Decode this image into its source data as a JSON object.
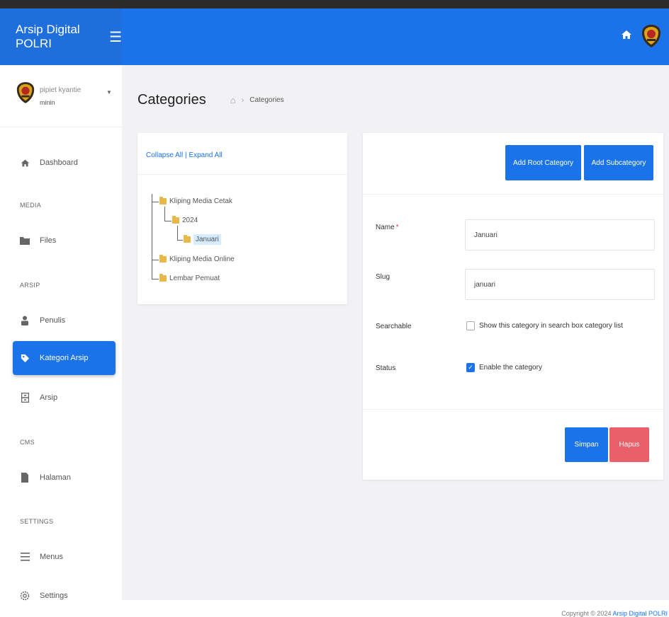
{
  "app": {
    "title": "Arsip Digital POLRI"
  },
  "user": {
    "name": "pipiet kyantie",
    "role": "minin"
  },
  "sidebar": {
    "dashboard": "Dashboard",
    "media_section": "MEDIA",
    "files": "Files",
    "arsip_section": "ARSIP",
    "penulis": "Penulis",
    "kategori": "Kategori Arsip",
    "arsip": "Arsip",
    "cms_section": "CMS",
    "halaman": "Halaman",
    "settings_section": "SETTINGS",
    "menus": "Menus",
    "settings": "Settings"
  },
  "page": {
    "title": "Categories",
    "breadcrumb_current": "Categories"
  },
  "tree": {
    "collapse_all": "Collapse All",
    "separator": "|",
    "expand_all": "Expand All",
    "nodes": {
      "kliping_cetak": "Kliping Media Cetak",
      "year_2024": "2024",
      "januari": "Januari",
      "kliping_online": "Kliping Media Online",
      "lembar_pemuat": "Lembar Pemuat"
    }
  },
  "form": {
    "add_root": "Add Root Category",
    "add_sub": "Add Subcategory",
    "name_label": "Name",
    "name_required": "*",
    "name_value": "Januari",
    "slug_label": "Slug",
    "slug_value": "januari",
    "searchable_label": "Searchable",
    "searchable_text": "Show this category in search box category list",
    "searchable_checked": false,
    "status_label": "Status",
    "status_text": "Enable the category",
    "status_checked": true,
    "save": "Simpan",
    "delete": "Hapus"
  },
  "footer": {
    "prefix": "Copyright © 2024",
    "brand": "Arsip Digital POLRI"
  },
  "colors": {
    "primary": "#1a73e8",
    "danger": "#e9606b",
    "background": "#f2f2f4"
  },
  "icons": {
    "menu": "hamburger-icon",
    "home": "home-icon",
    "dashboard": "home-icon",
    "files": "folder-icon",
    "penulis": "person-icon",
    "kategori": "tag-icon",
    "arsip": "archive-icon",
    "halaman": "page-icon",
    "menus": "list-icon",
    "settings": "gear-icon"
  }
}
